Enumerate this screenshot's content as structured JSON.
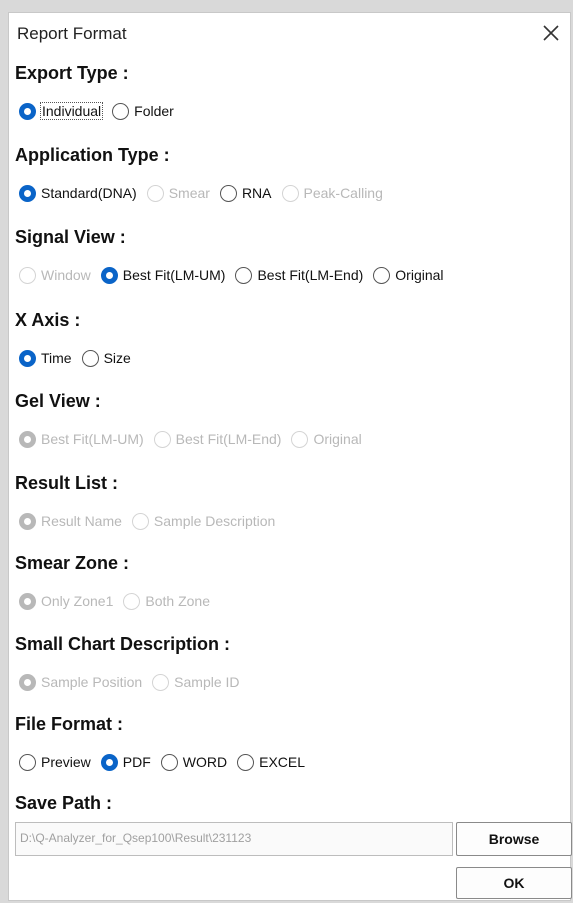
{
  "dialog": {
    "title": "Report Format",
    "close_glyph": "✕"
  },
  "sections": [
    {
      "label": "Export Type :",
      "options": [
        {
          "label": "Individual",
          "checked": true,
          "disabled": false,
          "focused": true
        },
        {
          "label": "Folder",
          "checked": false,
          "disabled": false
        }
      ]
    },
    {
      "label": "Application Type :",
      "options": [
        {
          "label": "Standard(DNA)",
          "checked": true,
          "disabled": false
        },
        {
          "label": "Smear",
          "checked": false,
          "disabled": true
        },
        {
          "label": "RNA",
          "checked": false,
          "disabled": false
        },
        {
          "label": "Peak-Calling",
          "checked": false,
          "disabled": true
        }
      ]
    },
    {
      "label": "Signal View :",
      "options": [
        {
          "label": "Window",
          "checked": false,
          "disabled": true
        },
        {
          "label": "Best Fit(LM-UM)",
          "checked": true,
          "disabled": false
        },
        {
          "label": "Best Fit(LM-End)",
          "checked": false,
          "disabled": false
        },
        {
          "label": "Original",
          "checked": false,
          "disabled": false
        }
      ]
    },
    {
      "label": "X Axis :",
      "options": [
        {
          "label": "Time",
          "checked": true,
          "disabled": false
        },
        {
          "label": "Size",
          "checked": false,
          "disabled": false
        }
      ]
    },
    {
      "label": "Gel View :",
      "options": [
        {
          "label": "Best Fit(LM-UM)",
          "checked": true,
          "disabled": true
        },
        {
          "label": "Best Fit(LM-End)",
          "checked": false,
          "disabled": true
        },
        {
          "label": "Original",
          "checked": false,
          "disabled": true
        }
      ]
    },
    {
      "label": "Result List :",
      "options": [
        {
          "label": "Result Name",
          "checked": true,
          "disabled": true
        },
        {
          "label": "Sample Description",
          "checked": false,
          "disabled": true
        }
      ]
    },
    {
      "label": "Smear Zone :",
      "options": [
        {
          "label": "Only Zone1",
          "checked": true,
          "disabled": true
        },
        {
          "label": "Both Zone",
          "checked": false,
          "disabled": true
        }
      ]
    },
    {
      "label": "Small Chart Description :",
      "options": [
        {
          "label": "Sample Position",
          "checked": true,
          "disabled": true
        },
        {
          "label": "Sample ID",
          "checked": false,
          "disabled": true
        }
      ]
    },
    {
      "label": "File Format :",
      "options": [
        {
          "label": "Preview",
          "checked": false,
          "disabled": false
        },
        {
          "label": "PDF",
          "checked": true,
          "disabled": false
        },
        {
          "label": "WORD",
          "checked": false,
          "disabled": false
        },
        {
          "label": "EXCEL",
          "checked": false,
          "disabled": false
        }
      ]
    }
  ],
  "save_path": {
    "label": "Save Path :",
    "value": "D:\\Q-Analyzer_for_Qsep100\\Result\\231123",
    "browse_label": "Browse"
  },
  "ok_label": "OK",
  "colors": {
    "accent": "#0a64c8",
    "disabled": "#b8b8b8"
  }
}
